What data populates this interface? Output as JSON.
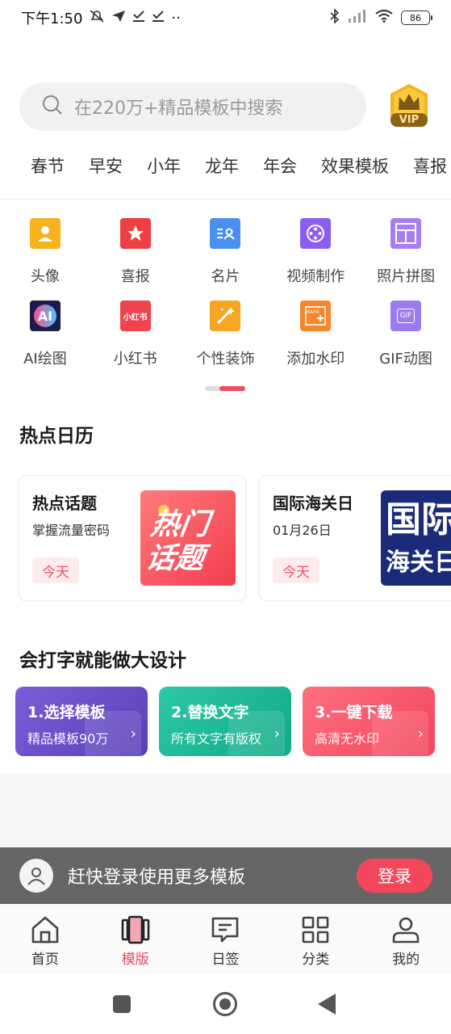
{
  "status_bar": {
    "time": "下午1:50",
    "extra": "··",
    "battery": "86"
  },
  "search": {
    "placeholder": "在220万+精品模板中搜索",
    "vip_label": "VIP"
  },
  "category_tabs": [
    "春节",
    "早安",
    "小年",
    "龙年",
    "年会",
    "效果模板",
    "喜报"
  ],
  "tools": [
    {
      "label": "头像",
      "icon": "avatar-icon",
      "color": "#f6b21f"
    },
    {
      "label": "喜报",
      "icon": "star-icon",
      "color": "#ee3f44"
    },
    {
      "label": "名片",
      "icon": "card-icon",
      "color": "#4a8ef0"
    },
    {
      "label": "视频制作",
      "icon": "film-icon",
      "color": "#8c5ef0"
    },
    {
      "label": "照片拼图",
      "icon": "collage-icon",
      "color": "#a77ef0"
    },
    {
      "label": "AI绘图",
      "icon": "ai-icon",
      "color": "#1b1c4a",
      "glyph": "AI"
    },
    {
      "label": "小红书",
      "icon": "xiaohongshu-icon",
      "color": "#ef4350",
      "glyph": "小红书"
    },
    {
      "label": "个性装饰",
      "icon": "magic-wand-icon",
      "color": "#f5a623"
    },
    {
      "label": "添加水印",
      "icon": "watermark-icon",
      "color": "#f7862a",
      "glyph": "MARK"
    },
    {
      "label": "GIF动图",
      "icon": "gif-icon",
      "color": "#9b7bef",
      "glyph": "GIF"
    }
  ],
  "hot_calendar": {
    "title": "热点日历",
    "cards": [
      {
        "title": "热点话题",
        "subtitle": "掌握流量密码",
        "badge": "今天",
        "thumb_text_1": "热门",
        "thumb_text_2": "话题"
      },
      {
        "title": "国际海关日",
        "subtitle": "01月26日",
        "badge": "今天",
        "thumb_text_1": "国际",
        "thumb_text_2": "海关日"
      }
    ]
  },
  "design_section": {
    "title": "会打字就能做大设计",
    "steps": [
      {
        "title": "1.选择模板",
        "subtitle": "精品模板90万",
        "color": "#6b4fc8"
      },
      {
        "title": "2.替换文字",
        "subtitle": "所有文字有版权",
        "color": "#19b998"
      },
      {
        "title": "3.一键下载",
        "subtitle": "高清无水印",
        "color": "#f5566a"
      }
    ]
  },
  "login_bar": {
    "text": "赶快登录使用更多模板",
    "button": "登录"
  },
  "bottom_nav": [
    {
      "label": "首页",
      "icon": "home-icon"
    },
    {
      "label": "模版",
      "icon": "template-icon",
      "active": true
    },
    {
      "label": "日签",
      "icon": "message-icon"
    },
    {
      "label": "分类",
      "icon": "grid-icon"
    },
    {
      "label": "我的",
      "icon": "profile-icon"
    }
  ],
  "colors": {
    "accent": "#f04c5c",
    "vip_gold": "#f6b21f"
  }
}
